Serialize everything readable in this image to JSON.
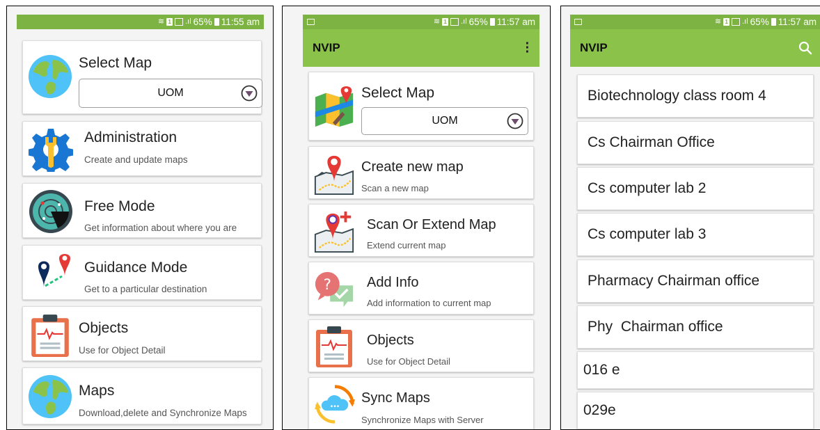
{
  "screen1": {
    "status": {
      "battery": "65%",
      "time": "11:55 am"
    },
    "select_map": {
      "title": "Select Map",
      "value": "UOM"
    },
    "items": [
      {
        "title": "Administration",
        "subtitle": "Create and update maps",
        "icon": "gear-wrench-icon"
      },
      {
        "title": "Free Mode",
        "subtitle": "Get information about where you are",
        "icon": "radar-icon"
      },
      {
        "title": "Guidance Mode",
        "subtitle": "Get to a particular destination",
        "icon": "map-pins-icon"
      },
      {
        "title": "Objects",
        "subtitle": "Use for Object Detail",
        "icon": "clipboard-icon"
      },
      {
        "title": "Maps",
        "subtitle": "Download,delete and Synchronize Maps",
        "icon": "globe-icon"
      }
    ]
  },
  "screen2": {
    "status": {
      "battery": "65%",
      "time": "11:57 am"
    },
    "appbar": {
      "title": "NVIP"
    },
    "select_map": {
      "title": "Select Map",
      "value": "UOM"
    },
    "items": [
      {
        "title": "Create new map",
        "subtitle": "Scan a new map",
        "icon": "map-pin-icon"
      },
      {
        "title": "Scan Or Extend Map",
        "subtitle": "Extend current map",
        "icon": "map-pin-add-icon"
      },
      {
        "title": "Add Info",
        "subtitle": "Add information to current map",
        "icon": "chat-question-icon"
      },
      {
        "title": "Objects",
        "subtitle": "Use for Object Detail",
        "icon": "clipboard-icon"
      },
      {
        "title": "Sync Maps",
        "subtitle": "Synchronize Maps with Server",
        "icon": "cloud-sync-icon"
      }
    ]
  },
  "screen3": {
    "status": {
      "battery": "65%",
      "time": "11:57 am"
    },
    "appbar": {
      "title": "NVIP"
    },
    "list": [
      "Biotechnology class room 4",
      "Cs Chairman Office",
      "Cs computer lab 2",
      "Cs computer lab 3",
      "Pharmacy Chairman office",
      "Phy  Chairman office",
      "016 e",
      "029e"
    ]
  },
  "colors": {
    "statusbar": "#7cb342",
    "appbar": "#8bc34a",
    "accent": "#e53935"
  }
}
